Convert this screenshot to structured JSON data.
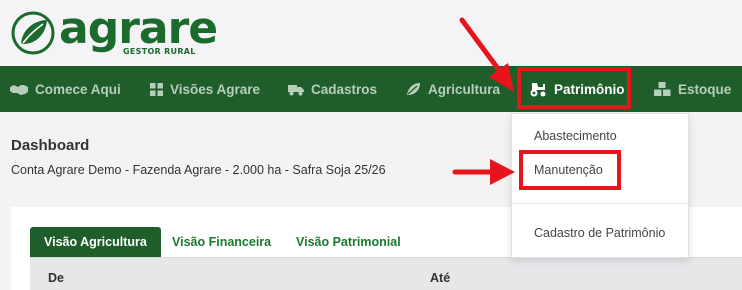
{
  "brand": {
    "name": "agrare",
    "tagline": "GESTOR RURAL",
    "color": "#1a6b2c"
  },
  "nav": {
    "background": "#1f5e2a",
    "items": [
      {
        "label": "Comece Aqui",
        "icon": "handshake-icon"
      },
      {
        "label": "Visões Agrare",
        "icon": "grid-icon"
      },
      {
        "label": "Cadastros",
        "icon": "truck-icon"
      },
      {
        "label": "Agricultura",
        "icon": "leaf-icon"
      },
      {
        "label": "Patrimônio",
        "icon": "tractor-icon",
        "active": true
      },
      {
        "label": "Estoque",
        "icon": "boxes-icon"
      }
    ]
  },
  "dropdown": {
    "items": [
      {
        "label": "Abastecimento"
      },
      {
        "label": "Manutenção",
        "highlighted": true
      },
      {
        "label": "Cadastro de Patrimônio"
      }
    ]
  },
  "page": {
    "title": "Dashboard",
    "subtitle": "Conta Agrare Demo - Fazenda Agrare - 2.000 ha - Safra Soja 25/26"
  },
  "tabs": [
    {
      "label": "Visão Agricultura",
      "active": true
    },
    {
      "label": "Visão Financeira"
    },
    {
      "label": "Visão Patrimonial"
    }
  ],
  "table": {
    "headers": [
      "De",
      "Até"
    ]
  },
  "annotation_color": "#e8141c"
}
